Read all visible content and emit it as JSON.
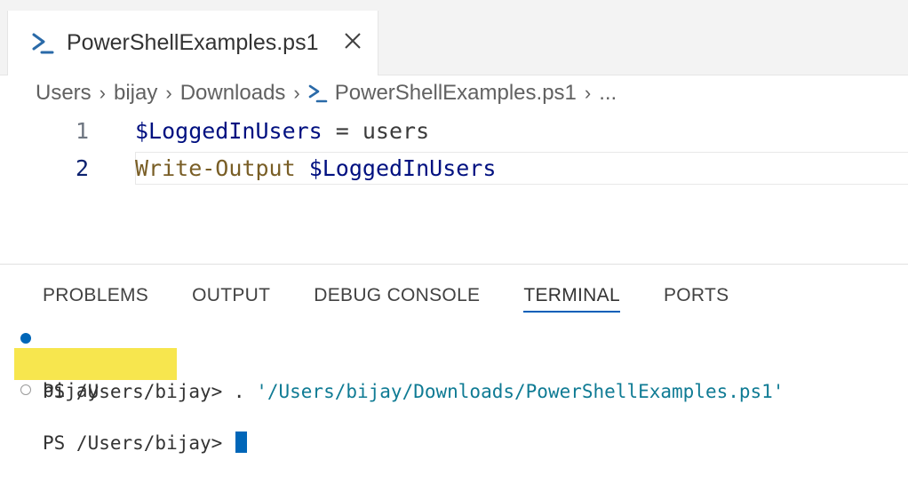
{
  "tab": {
    "label": "PowerShellExamples.ps1"
  },
  "breadcrumb": {
    "items": [
      "Users",
      "bijay",
      "Downloads",
      "PowerShellExamples.ps1",
      "..."
    ]
  },
  "editor": {
    "lines": [
      {
        "number": "1",
        "var": "$LoggedInUsers",
        "op": " = ",
        "rest": "users"
      },
      {
        "number": "2",
        "cmd": "Write-Output",
        "space": " ",
        "var": "$LoggedInUsers"
      }
    ]
  },
  "panel": {
    "tabs": [
      "PROBLEMS",
      "OUTPUT",
      "DEBUG CONSOLE",
      "TERMINAL",
      "PORTS"
    ],
    "active_tab": "TERMINAL"
  },
  "terminal": {
    "line1_prompt": "PS /Users/bijay> . ",
    "line1_path": "'/Users/bijay/Downloads/PowerShellExamples.ps1'",
    "line2_output": "bijay",
    "line3_prompt": "PS /Users/bijay> "
  },
  "colors": {
    "accent": "#005fb8",
    "terminal_cursor": "#0066b8",
    "highlight": "#f7e64e"
  }
}
